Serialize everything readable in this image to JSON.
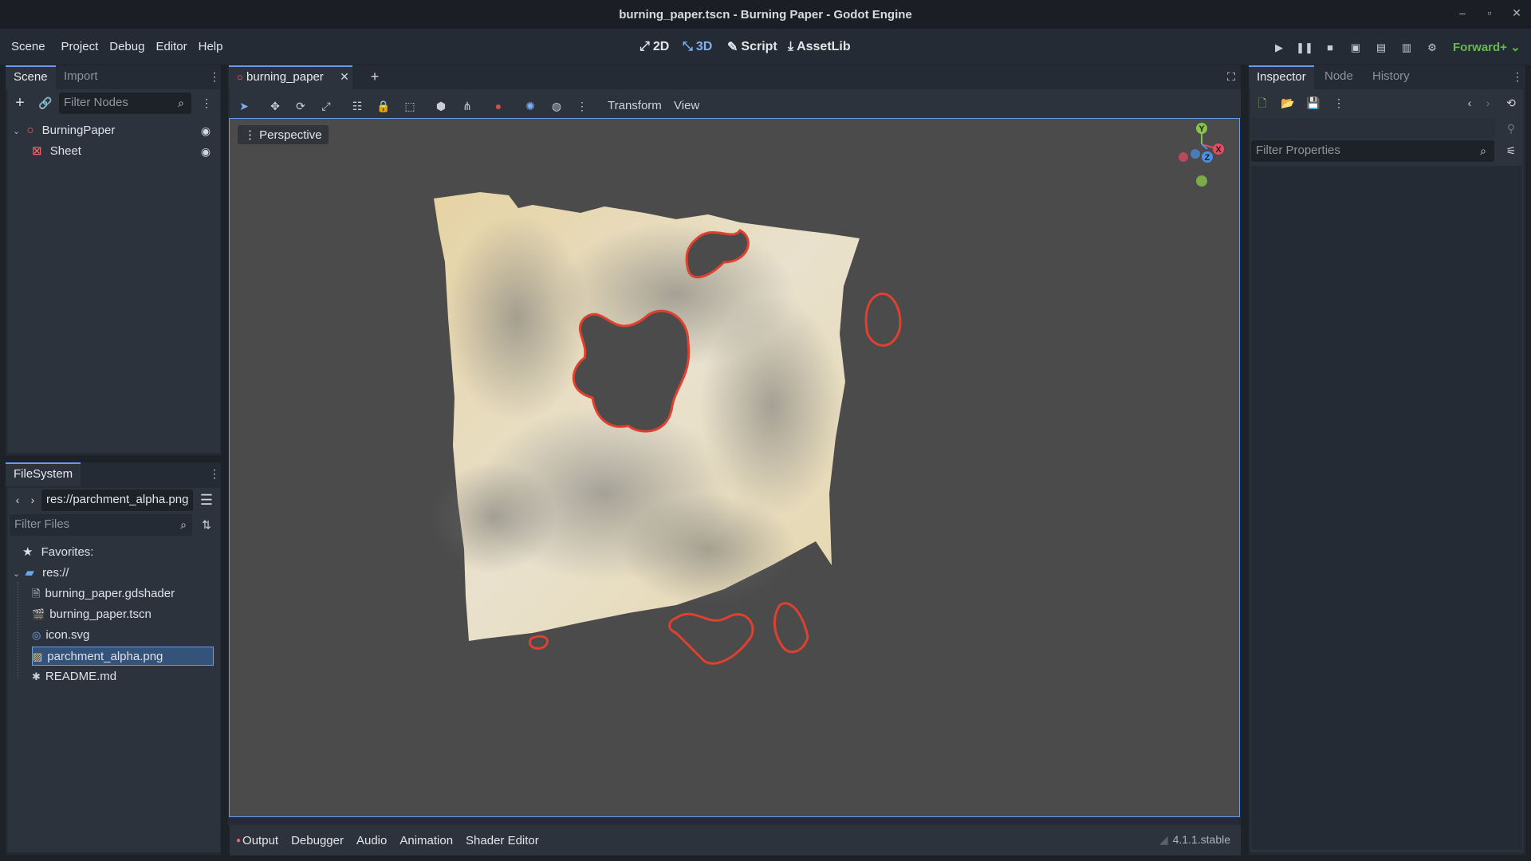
{
  "window": {
    "title": "burning_paper.tscn - Burning Paper - Godot Engine",
    "controls": [
      "–",
      "▫",
      "✕"
    ]
  },
  "menu": [
    "Scene",
    "Project",
    "Debug",
    "Editor",
    "Help"
  ],
  "main_screens": {
    "two_d": "2D",
    "three_d": "3D",
    "script": "Script",
    "assetlib": "AssetLib"
  },
  "renderer": "Forward+",
  "scene_dock": {
    "tabs": {
      "scene": "Scene",
      "import": "Import"
    },
    "filter_placeholder": "Filter Nodes",
    "nodes": [
      {
        "name": "BurningPaper"
      },
      {
        "name": "Sheet"
      }
    ]
  },
  "filesystem_dock": {
    "tab": "FileSystem",
    "path": "res://parchment_alpha.png",
    "filter_placeholder": "Filter Files",
    "favorites": "Favorites:",
    "root": "res://",
    "files": [
      {
        "name": "burning_paper.gdshader",
        "icon": "shader-file-icon"
      },
      {
        "name": "burning_paper.tscn",
        "icon": "scene-file-icon"
      },
      {
        "name": "icon.svg",
        "icon": "svg-file-icon"
      },
      {
        "name": "parchment_alpha.png",
        "icon": "image-file-icon",
        "selected": true
      },
      {
        "name": "README.md",
        "icon": "text-file-icon"
      }
    ]
  },
  "editor": {
    "scene_tab": "burning_paper",
    "viewport_menu": {
      "transform": "Transform",
      "view": "View"
    },
    "perspective_label": "Perspective",
    "gizmo": {
      "x": "X",
      "y": "Y",
      "z": "Z"
    }
  },
  "bottom_panel": {
    "tabs": [
      "Output",
      "Debugger",
      "Audio",
      "Animation",
      "Shader Editor"
    ],
    "version": "4.1.1.stable"
  },
  "inspector_dock": {
    "tabs": {
      "inspector": "Inspector",
      "node": "Node",
      "history": "History"
    },
    "filter_placeholder": "Filter Properties"
  },
  "colors": {
    "accent": "#699ce8",
    "background": "#1d2229",
    "panel": "#252b34",
    "dock": "#2d333d",
    "viewport": "#4b4b4b",
    "burn_edge": "#e0402e",
    "renderer_green": "#69b950"
  }
}
